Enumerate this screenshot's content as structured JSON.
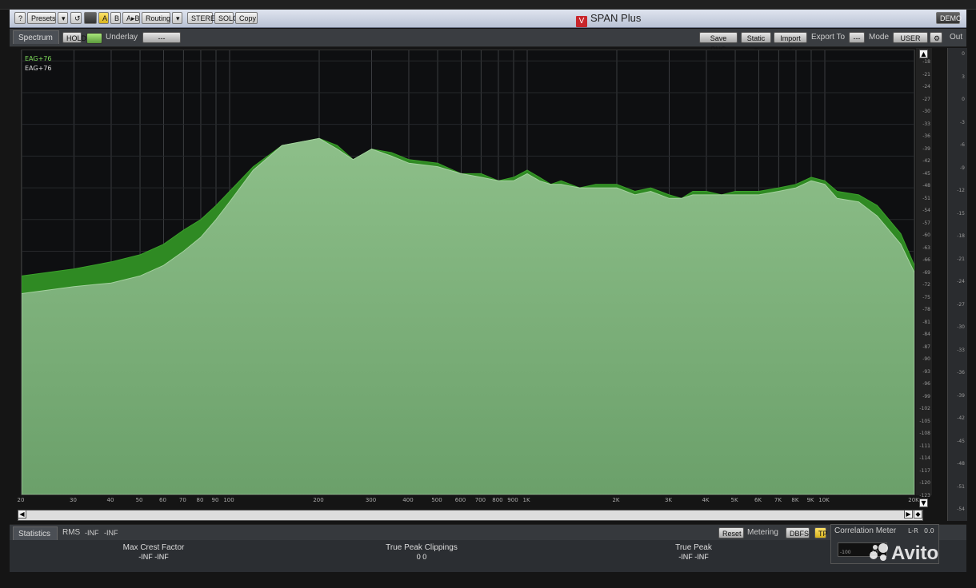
{
  "window": {
    "title": "SPAN Plus",
    "demo_badge": "DEMO"
  },
  "toolbar": {
    "help": "?",
    "presets": "Presets",
    "dropdown": "▾",
    "undo": "↺",
    "a": "A",
    "b": "B",
    "ab": "A▸B",
    "routing": "Routing",
    "stereo": "STEREO",
    "solo": "SOLO",
    "copy": "Copy"
  },
  "panel": {
    "spectrum_tab": "Spectrum",
    "hold": "HOLD",
    "underlay_label": "Underlay",
    "underlay_value": "---",
    "save_png": "Save PNG",
    "static": "Static ▾",
    "import": "Import ▾",
    "export_label": "Export To",
    "export_value": "---",
    "mode_label": "Mode",
    "mode_value": "USER",
    "out_tab": "Out"
  },
  "legend": [
    "EAG+76",
    "EAG+76"
  ],
  "colors": {
    "primary_fill": "#86b883",
    "secondary_fill": "#2f8a23",
    "background": "#0e0f11",
    "grid": "#3b3d40"
  },
  "chart_data": {
    "type": "area",
    "title": "",
    "xscale": "log",
    "xlim": [
      20,
      20000
    ],
    "ylim": [
      -150,
      -24
    ],
    "ylabel": "",
    "xlabel": "",
    "xticks": [
      20,
      30,
      40,
      50,
      60,
      70,
      80,
      90,
      100,
      200,
      300,
      400,
      500,
      600,
      700,
      800,
      900,
      1000,
      2000,
      3000,
      4000,
      5000,
      6000,
      7000,
      8000,
      9000,
      10000,
      20000
    ],
    "xtick_labels": [
      "20",
      "30",
      "40",
      "50",
      "60",
      "70",
      "80",
      "90",
      "100",
      "200",
      "300",
      "400",
      "500",
      "600",
      "700",
      "800",
      "900",
      "1K",
      "2K",
      "3K",
      "4K",
      "5K",
      "6K",
      "7K",
      "8K",
      "9K",
      "10K",
      "20K"
    ],
    "series": [
      {
        "name": "EAG+76",
        "x": [
          20,
          30,
          40,
          50,
          60,
          70,
          80,
          90,
          100,
          120,
          150,
          200,
          230,
          260,
          300,
          350,
          400,
          500,
          600,
          700,
          800,
          900,
          1000,
          1100,
          1200,
          1300,
          1500,
          1700,
          2000,
          2300,
          2600,
          3000,
          3300,
          3600,
          4000,
          4500,
          5000,
          6000,
          7000,
          8000,
          9000,
          10000,
          11000,
          13000,
          15000,
          18000,
          20000
        ],
        "y": [
          -88,
          -86,
          -84,
          -82,
          -79,
          -75,
          -72,
          -68,
          -64,
          -57,
          -51,
          -49,
          -51,
          -55,
          -52,
          -53,
          -55,
          -56,
          -59,
          -59,
          -61,
          -60,
          -58,
          -60,
          -62,
          -61,
          -63,
          -62,
          -62,
          -64,
          -63,
          -65,
          -66,
          -64,
          -64,
          -65,
          -64,
          -64,
          -63,
          -62,
          -60,
          -61,
          -64,
          -65,
          -68,
          -76,
          -85
        ]
      },
      {
        "name": "EAG+76",
        "x": [
          20,
          30,
          40,
          50,
          60,
          70,
          80,
          90,
          100,
          120,
          150,
          200,
          230,
          260,
          300,
          350,
          400,
          500,
          600,
          700,
          800,
          900,
          1000,
          1100,
          1200,
          1300,
          1500,
          1700,
          2000,
          2300,
          2600,
          3000,
          3300,
          3600,
          4000,
          4500,
          5000,
          6000,
          7000,
          8000,
          9000,
          10000,
          11000,
          13000,
          15000,
          18000,
          20000
        ],
        "y": [
          -93,
          -91,
          -90,
          -88,
          -85,
          -81,
          -77,
          -72,
          -67,
          -58,
          -51,
          -49,
          -52,
          -55,
          -52,
          -54,
          -56,
          -57,
          -59,
          -60,
          -61,
          -61,
          -59,
          -61,
          -62,
          -62,
          -63,
          -63,
          -63,
          -65,
          -64,
          -66,
          -66,
          -65,
          -65,
          -65,
          -65,
          -65,
          -64,
          -63,
          -61,
          -62,
          -66,
          -67,
          -71,
          -79,
          -87
        ]
      }
    ]
  },
  "db_scale": [
    "-18",
    "-21",
    "-24",
    "-27",
    "-30",
    "-33",
    "-36",
    "-39",
    "-42",
    "-45",
    "-48",
    "-51",
    "-54",
    "-57",
    "-60",
    "-63",
    "-66",
    "-69",
    "-72",
    "-75",
    "-78",
    "-81",
    "-84",
    "-87",
    "-90",
    "-93",
    "-96",
    "-99",
    "-102",
    "-105",
    "-108",
    "-111",
    "-114",
    "-117",
    "-120",
    "-123"
  ],
  "out_scale": [
    "0",
    "3",
    "0",
    "-3",
    "-6",
    "-9",
    "-12",
    "-15",
    "-18",
    "-21",
    "-24",
    "-27",
    "-30",
    "-33",
    "-36",
    "-39",
    "-42",
    "-45",
    "-48",
    "-51",
    "-54",
    "-57"
  ],
  "statistics": {
    "tab": "Statistics",
    "rms_label": "RMS",
    "rms_l": "-INF",
    "rms_r": "-INF",
    "reset": "Reset",
    "metering_label": "Metering",
    "metering_value": "DBFS",
    "tp": "TP",
    "max_crest_label": "Max Crest Factor",
    "max_crest_value": "-INF   -INF",
    "true_peak_clip_label": "True Peak Clippings",
    "true_peak_clip_value": "0     0",
    "true_peak_label": "True Peak",
    "true_peak_value": "-INF   -INF"
  },
  "correlation": {
    "label": "Correlation Meter",
    "lr_label": "L-R",
    "lr_value": "0.0",
    "scale_left": "-100",
    "scale_mid": "-50"
  },
  "watermark": "Avito"
}
